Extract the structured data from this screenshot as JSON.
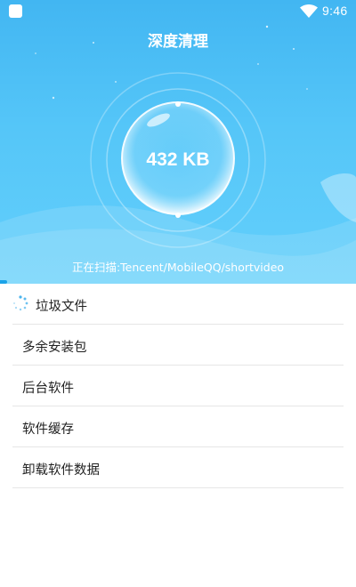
{
  "statusbar": {
    "time": "9:46",
    "icons": [
      "app-square-icon",
      "wifi-icon"
    ]
  },
  "header": {
    "title": "深度清理",
    "size_value": "432 KB",
    "scan_status": "正在扫描:Tencent/MobileQQ/shortvideo",
    "progress": 0.02
  },
  "colors": {
    "header_top": "#42b6f2",
    "header_bottom": "#63cffb",
    "progress": "#1aa3e8"
  },
  "categories": [
    {
      "label": "垃圾文件",
      "state": "scanning"
    },
    {
      "label": "多余安装包"
    },
    {
      "label": "后台软件"
    },
    {
      "label": "软件缓存"
    },
    {
      "label": "卸载软件数据"
    }
  ]
}
